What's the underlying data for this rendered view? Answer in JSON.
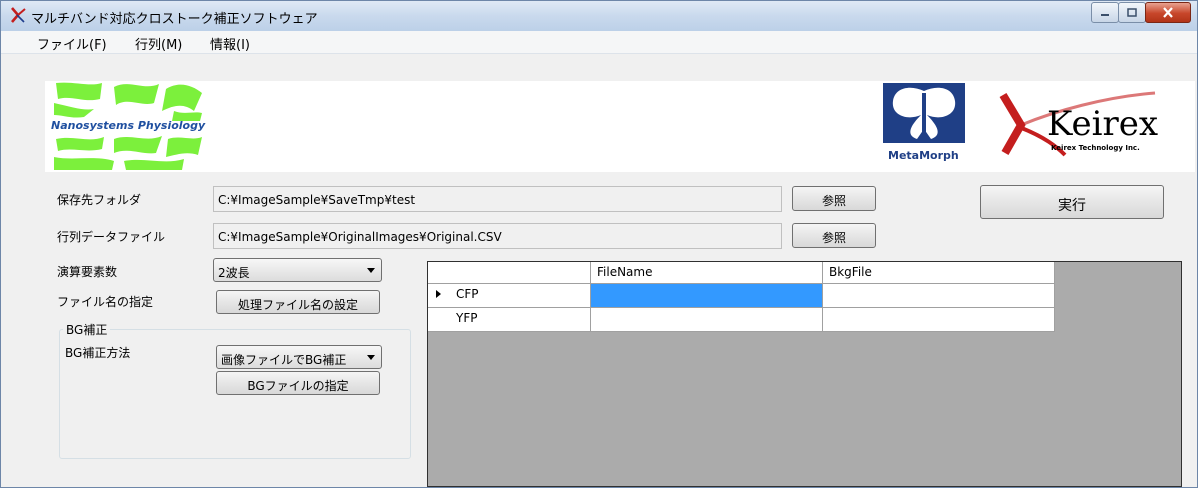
{
  "window": {
    "title": "マルチバンド対応クロストーク補正ソフトウェア",
    "controls": {
      "minimize": "",
      "maximize": "",
      "close": ""
    }
  },
  "menu": [
    "ファイル(F)",
    "行列(M)",
    "情報(I)"
  ],
  "logos": {
    "left": "Nanosystems Physiology",
    "center": "MetaMorph",
    "right_name": "Keirex",
    "right_sub": "Keirex Technology Inc."
  },
  "form": {
    "save_folder": {
      "label": "保存先フォルダ",
      "value": "C:¥ImageSample¥SaveTmp¥test",
      "browse": "参照"
    },
    "matrix_file": {
      "label": "行列データファイル",
      "value": "C:¥ImageSample¥OriginalImages¥Original.CSV",
      "browse": "参照"
    },
    "execute": "実行",
    "elements": {
      "label": "演算要素数",
      "selected": "2波長"
    },
    "filename": {
      "label": "ファイル名の指定",
      "button": "処理ファイル名の設定"
    },
    "bg": {
      "group_title": "BG補正",
      "method_label": "BG補正方法",
      "method_selected": "画像ファイルでBG補正",
      "file_button": "BGファイルの指定"
    }
  },
  "grid": {
    "columns": [
      "FileName",
      "BkgFile"
    ],
    "rows": [
      {
        "label": "CFP",
        "filename": "",
        "bkgfile": "",
        "current": true
      },
      {
        "label": "YFP",
        "filename": "",
        "bkgfile": "",
        "current": false
      }
    ]
  },
  "colors": {
    "selection": "#3399ff",
    "grid_background": "#ababab",
    "logo_green": "#7cf03c",
    "keirex_red": "#c41e1e"
  }
}
